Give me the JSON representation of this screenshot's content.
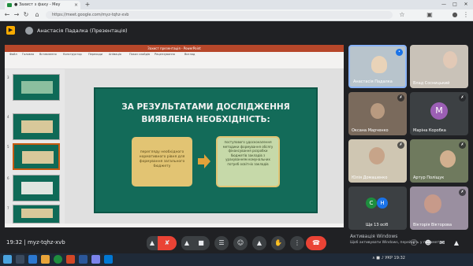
{
  "browser": {
    "tab_title": "● Захист з фаху - Меу",
    "tab_close": "×",
    "new_tab": "+",
    "url": "https://meet.google.com/myz-tqhz-xvb",
    "window_buttons": [
      "—",
      "□",
      "✕"
    ]
  },
  "meet": {
    "logo_glyph": "▶",
    "presenter_label": "Анастасія Падалка (Презентація)",
    "meeting_time": "19:32  |  myz-tqhz-xvb",
    "activate_windows": [
      "Активація Windows",
      "Щоб активувати Windows, перейдіть у параметри."
    ]
  },
  "powerpoint": {
    "title_bar": "Захист презентація - PowerPoint",
    "ribbon_tabs": [
      "Файл",
      "Головна",
      "Вставлення",
      "Конструктор",
      "Переходи",
      "Анімація",
      "Показ слайдів",
      "Рецензування",
      "Вигляд"
    ],
    "thumbnail_numbers": [
      "3",
      "4",
      "5",
      "6",
      "7"
    ],
    "slide": {
      "title": "ЗА РЕЗУЛЬТАТАМИ ДОСЛІДЖЕННЯ ВИЯВЛЕНА НЕОБХІДНІСТЬ:",
      "left_box": "перегляду необхідного нормативного рівня для формування загального бюджету",
      "right_box": "поступового удосконалення методики формування обсягу фінансування розробки бюджетів закладів з урахуванням комунальних потреб освітніх закладів"
    }
  },
  "participants": [
    {
      "name": "Анастасія Падалка",
      "initial": "",
      "color": "#b8c4cc"
    },
    {
      "name": "Влад Сосницький",
      "initial": "",
      "color": "#c9c2b8"
    },
    {
      "name": "Оксана Марченко",
      "initial": "",
      "color": "#7a6a5c"
    },
    {
      "name": "Маріна Коробка",
      "initial": "M",
      "color": "#9c5fb5"
    },
    {
      "name": "Юлія Домашенко",
      "initial": "",
      "color": "#cfc6b2"
    },
    {
      "name": "Артур Поліщук",
      "initial": "",
      "color": "#6f7a5e"
    },
    {
      "name": "Ще 13 осіб",
      "initial": "",
      "color": "#3c4043"
    },
    {
      "name": "Вікторія Вікторова",
      "initial": "",
      "color": "#9a8fa0"
    }
  ],
  "more_participants": {
    "a": "С",
    "b": "Н"
  },
  "controls": {
    "more_options": "▲",
    "mic": "✘",
    "camera": "■",
    "captions": "☰",
    "emoji": "☺",
    "present": "▲",
    "raise_hand": "✋",
    "more": "⋮",
    "hangup": "☎"
  },
  "taskbar": {
    "tray": "∧  ■  ♪  УКР  19:32"
  },
  "colors": {
    "slide_bg": "#136b59",
    "box_left": "#e2c473",
    "box_right": "#c6d9a9",
    "hangup": "#ea4335",
    "ppt_brand": "#b7472a"
  }
}
